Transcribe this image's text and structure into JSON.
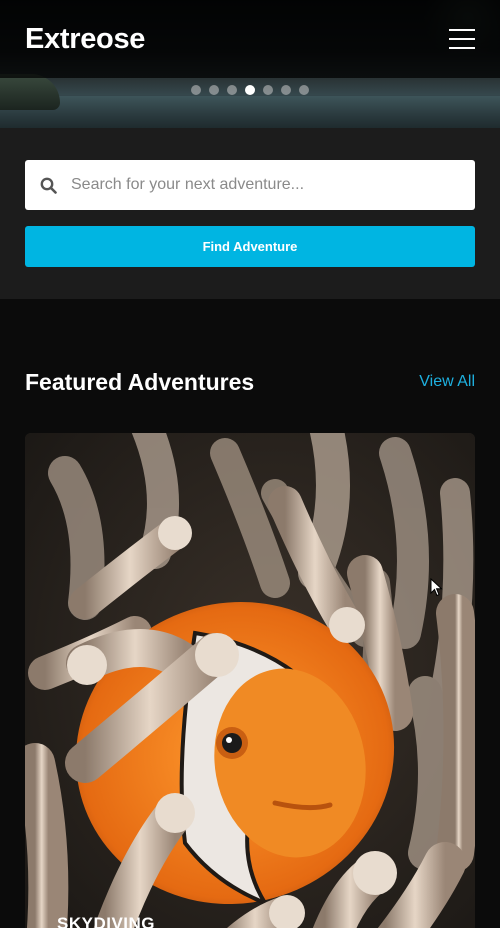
{
  "navbar": {
    "brand": "Extreose",
    "menu_icon": "hamburger-menu-icon"
  },
  "carousel": {
    "slide_count": 7,
    "active_index": 3
  },
  "search": {
    "placeholder": "Search for your next adventure...",
    "value": "",
    "search_icon": "search-icon",
    "button_label": "Find Adventure"
  },
  "featured": {
    "title": "Featured Adventures",
    "view_all_label": "View All",
    "cards": [
      {
        "category": "SKYDIVING",
        "image": "clownfish-in-anemone"
      }
    ]
  },
  "colors": {
    "accent": "#00b5e2",
    "link": "#1eb0df",
    "page_bg": "#0b0b0b",
    "search_section_bg": "#1c1c1c"
  }
}
